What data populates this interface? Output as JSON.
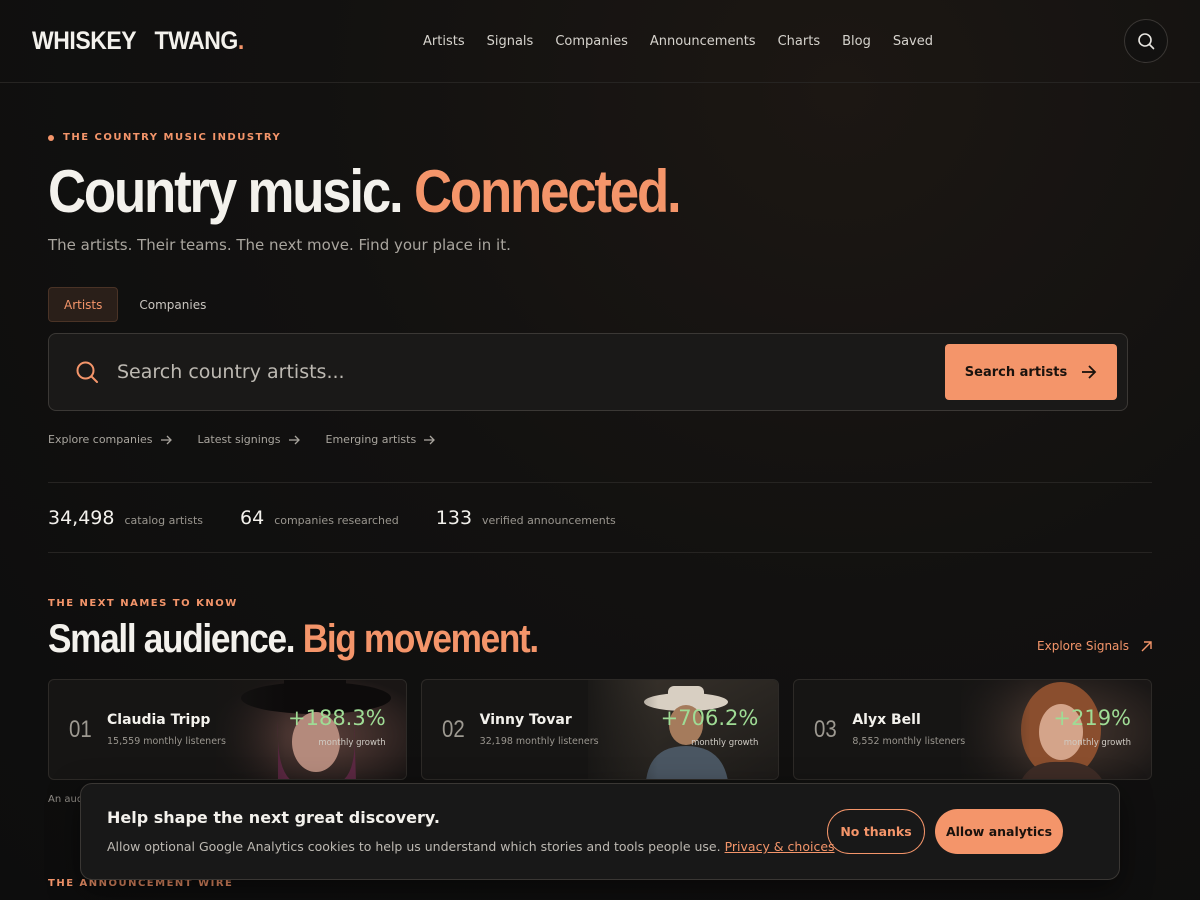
{
  "header": {
    "logo_word1": "WHISKEY",
    "logo_word2": "TWANG",
    "logo_dot": ".",
    "nav": [
      "Artists",
      "Signals",
      "Companies",
      "Announcements",
      "Charts",
      "Blog",
      "Saved"
    ],
    "search_icon": "search-icon"
  },
  "hero": {
    "eyebrow": "THE COUNTRY MUSIC INDUSTRY",
    "headline_main": "Country music.",
    "headline_accent": "Connected.",
    "subline": "The artists. Their teams. The next move. Find your place in it.",
    "tabs": [
      {
        "label": "Artists",
        "active": true
      },
      {
        "label": "Companies",
        "active": false
      }
    ],
    "search": {
      "placeholder": "Search country artists...",
      "button_label": "Search artists"
    },
    "quick_links": [
      "Explore companies",
      "Latest signings",
      "Emerging artists"
    ]
  },
  "stats": [
    {
      "value": "34,498",
      "label": "catalog artists"
    },
    {
      "value": "64",
      "label": "companies researched"
    },
    {
      "value": "133",
      "label": "verified announcements"
    }
  ],
  "next_names": {
    "eyebrow": "THE NEXT NAMES TO KNOW",
    "title_main": "Small audience.",
    "title_accent": "Big movement.",
    "explore_label": "Explore Signals",
    "cards": [
      {
        "rank": "01",
        "name": "Claudia Tripp",
        "listeners": "15,559 monthly listeners",
        "growth": "+188.3%",
        "growth_label": "monthly growth"
      },
      {
        "rank": "02",
        "name": "Vinny Tovar",
        "listeners": "32,198 monthly listeners",
        "growth": "+706.2%",
        "growth_label": "monthly growth"
      },
      {
        "rank": "03",
        "name": "Alyx Bell",
        "listeners": "8,552 monthly listeners",
        "growth": "+219%",
        "growth_label": "monthly growth"
      }
    ],
    "note_visible": "An aud"
  },
  "wire": {
    "eyebrow": "THE ANNOUNCEMENT WIRE"
  },
  "cookie": {
    "title": "Help shape the next great discovery.",
    "body": "Allow optional Google Analytics cookies to help us understand which stories and tools people use.",
    "link": "Privacy & choices",
    "decline": "No thanks",
    "accept": "Allow analytics"
  },
  "colors": {
    "accent": "#f4956a",
    "growth": "#9fdc95",
    "background": "#0e0e0e"
  }
}
